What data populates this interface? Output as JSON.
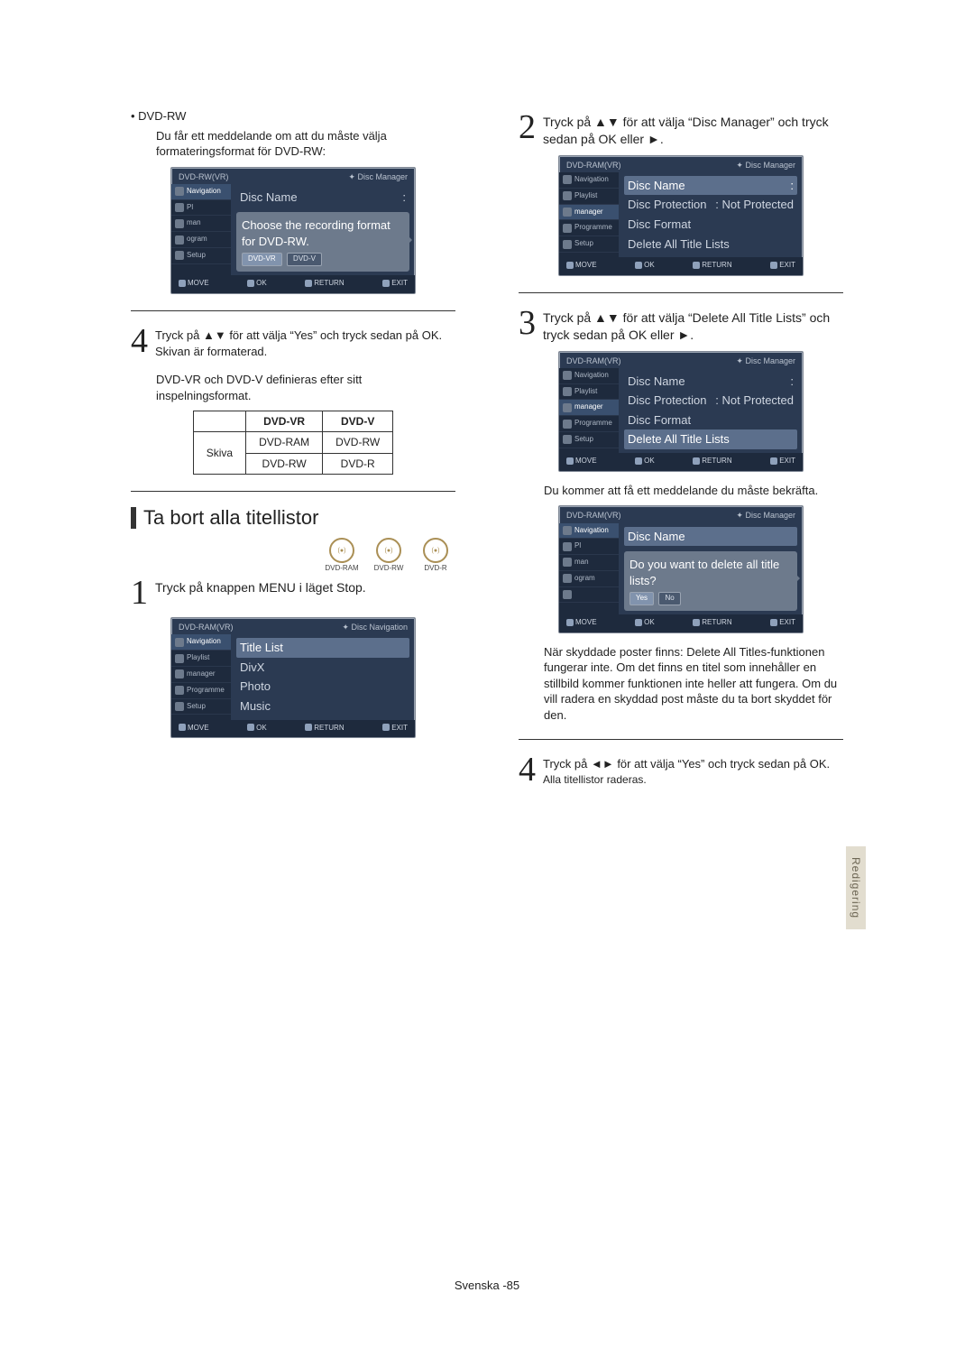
{
  "left": {
    "bullet_main": "DVD-RW",
    "bullet_sub": "Du får ett meddelande om att du måste välja formateringsformat för DVD-RW:",
    "tv1": {
      "header_left": "DVD-RW(VR)",
      "header_right": "Disc Manager",
      "side": [
        "Navigation",
        "Pl",
        "man",
        "ogram",
        "Setup"
      ],
      "side_active": 0,
      "main_rows": [
        {
          "l": "Disc Name",
          "r": ":"
        }
      ],
      "hint_text": "Choose the recording format for DVD-RW.",
      "hint_btns": [
        "DVD-VR",
        "DVD-V"
      ],
      "hint_sel": 0,
      "footer": [
        "MOVE",
        "OK",
        "RETURN",
        "EXIT"
      ]
    },
    "step4_text": "Tryck på ▲▼ för att välja “Yes” och tryck sedan på OK.",
    "step4_after": "Skivan är formaterad.",
    "vr_note": "DVD-VR och DVD-V definieras efter sitt inspelningsformat.",
    "table": {
      "h1": "DVD-VR",
      "h2": "DVD-V",
      "rlabel": "Skiva",
      "c11": "DVD-RAM",
      "c12": "DVD-RW",
      "c21": "DVD-RW",
      "c22": "DVD-R"
    },
    "section_title": "Ta bort alla titellistor",
    "discs": [
      "DVD-RAM",
      "DVD-RW",
      "DVD-R"
    ],
    "step1_text": "Tryck på knappen MENU i läget Stop.",
    "tv2": {
      "header_left": "DVD-RAM(VR)",
      "header_right": "Disc Navigation",
      "side": [
        "Navigation",
        "Playlist",
        "manager",
        "Programme",
        "Setup"
      ],
      "side_active": 0,
      "main_rows": [
        {
          "l": "Title List",
          "r": ""
        },
        {
          "l": "DivX",
          "r": ""
        },
        {
          "l": "Photo",
          "r": ""
        },
        {
          "l": "Music",
          "r": ""
        }
      ],
      "footer": [
        "MOVE",
        "OK",
        "RETURN",
        "EXIT"
      ]
    }
  },
  "right": {
    "step2_text": "Tryck på ▲▼ för att välja “Disc Manager” och tryck sedan på OK eller ►.",
    "tv_a": {
      "header_left": "DVD-RAM(VR)",
      "header_right": "Disc Manager",
      "side": [
        "Navigation",
        "Playlist",
        "manager",
        "Programme",
        "Setup"
      ],
      "side_active": 2,
      "main_rows": [
        {
          "l": "Disc Name",
          "r": ":"
        },
        {
          "l": "Disc Protection",
          "r": ": Not Protected"
        },
        {
          "l": "Disc Format",
          "r": ""
        },
        {
          "l": "Delete All Title Lists",
          "r": ""
        }
      ],
      "sel_row": 0,
      "footer": [
        "MOVE",
        "OK",
        "RETURN",
        "EXIT"
      ]
    },
    "step3_text": "Tryck på ▲▼ för att välja “Delete All Title Lists” och tryck sedan på OK eller ►.",
    "tv_b": {
      "header_left": "DVD-RAM(VR)",
      "header_right": "Disc Manager",
      "side": [
        "Navigation",
        "Playlist",
        "manager",
        "Programme",
        "Setup"
      ],
      "side_active": 2,
      "main_rows": [
        {
          "l": "Disc Name",
          "r": ":"
        },
        {
          "l": "Disc Protection",
          "r": ": Not Protected"
        },
        {
          "l": "Disc Format",
          "r": ""
        },
        {
          "l": "Delete All Title Lists",
          "r": ""
        }
      ],
      "sel_row": 3,
      "footer": [
        "MOVE",
        "OK",
        "RETURN",
        "EXIT"
      ]
    },
    "confirm_text": "Du kommer att få ett meddelande du måste bekräfta.",
    "tv_c": {
      "header_left": "DVD-RAM(VR)",
      "header_right": "Disc Manager",
      "side": [
        "Navigation",
        "Pl",
        "man",
        "ogram",
        ""
      ],
      "side_active": 0,
      "hint_text": "Do you want to delete all title lists?",
      "hint_btns": [
        "Yes",
        "No"
      ],
      "hint_sel": 0,
      "main_rows": [
        {
          "l": "Disc Name",
          "r": ""
        }
      ],
      "footer": [
        "MOVE",
        "OK",
        "RETURN",
        "EXIT"
      ]
    },
    "protected_note": "När skyddade poster finns: Delete All Titles-funktionen fungerar inte. Om det finns en titel som innehåller en stillbild kommer funktionen inte heller att fungera. Om du vill radera en skyddad post måste du ta bort skyddet för den.",
    "step4_text": "Tryck på ◄► för att välja “Yes” och tryck sedan på OK.",
    "step4_after": "Alla titellistor raderas."
  },
  "side_tab": "Redigering",
  "footer": {
    "lang": "Svenska -",
    "page": "85"
  }
}
